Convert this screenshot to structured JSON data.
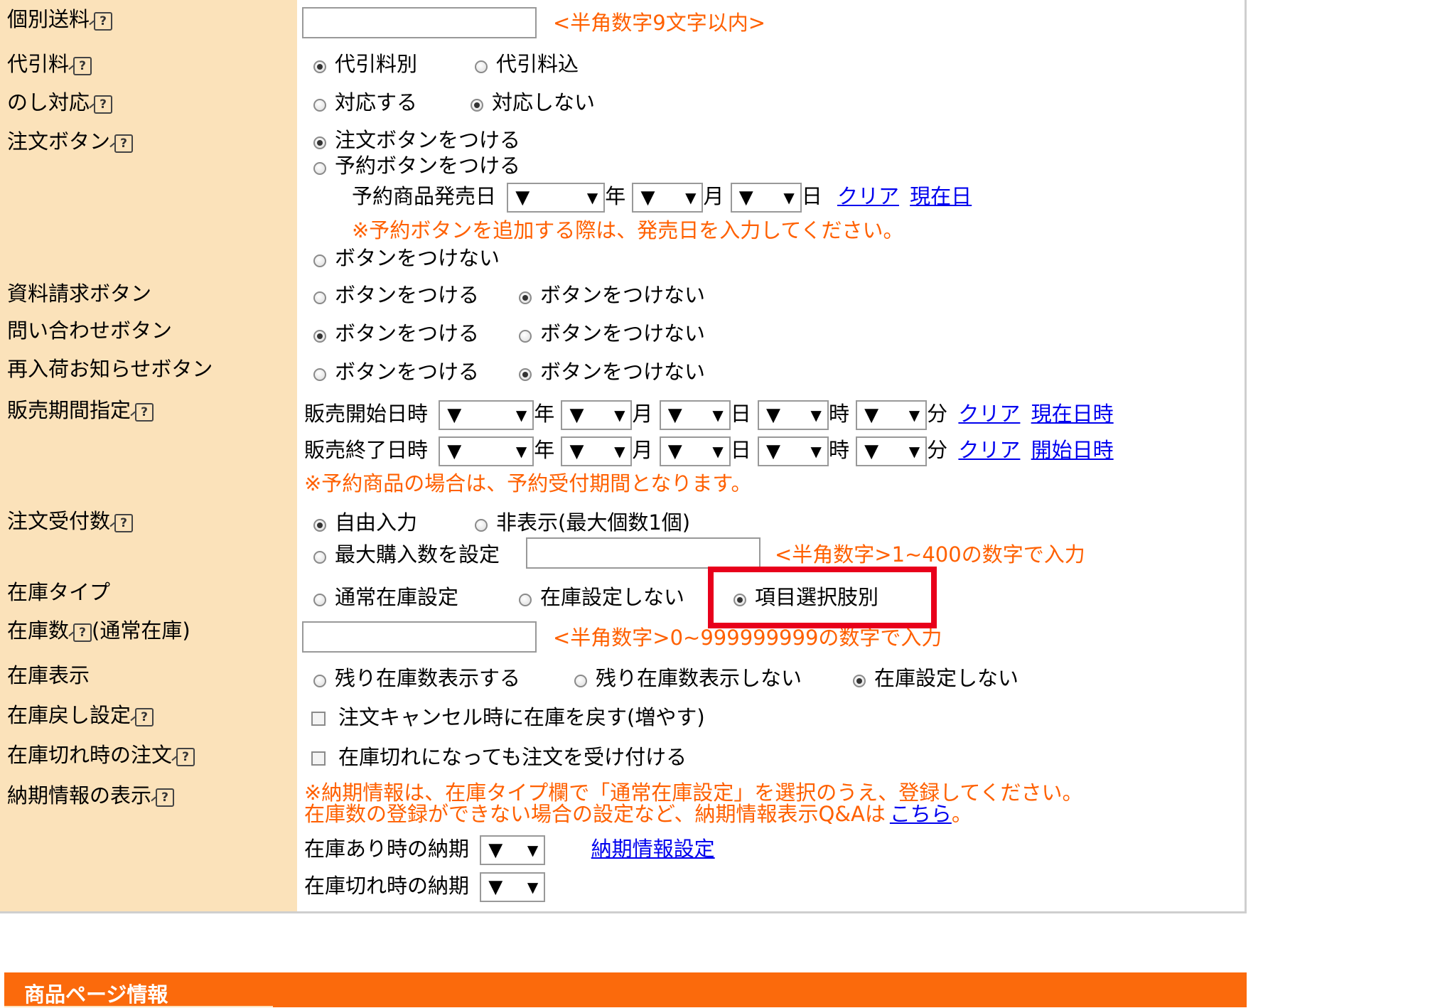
{
  "colors": {
    "label_bg": "#fbe2ba",
    "note": "#ff6000",
    "link": "#0000ee",
    "section_bar": "#fb6a0c",
    "highlight": "#e8001b"
  },
  "select_glyph": "▼",
  "rows": {
    "shipping": {
      "label": "個別送料",
      "note": "<半角数字9文字以内>"
    },
    "cod": {
      "label": "代引料",
      "opt1": "代引料別",
      "opt2": "代引料込"
    },
    "noshi": {
      "label": "のし対応",
      "opt1": "対応する",
      "opt2": "対応しない"
    },
    "order_button": {
      "label": "注文ボタン",
      "opt1": "注文ボタンをつける",
      "opt2": "予約ボタンをつける",
      "release_label": "予約商品発売日",
      "year": "年",
      "month": "月",
      "day": "日",
      "clear": "クリア",
      "today": "現在日",
      "note": "※予約ボタンを追加する際は、発売日を入力してください。",
      "opt3": "ボタンをつけない"
    },
    "request_button": {
      "label": "資料請求ボタン",
      "opt1": "ボタンをつける",
      "opt2": "ボタンをつけない"
    },
    "inquiry_button": {
      "label": "問い合わせボタン",
      "opt1": "ボタンをつける",
      "opt2": "ボタンをつけない"
    },
    "restock_button": {
      "label": "再入荷お知らせボタン",
      "opt1": "ボタンをつける",
      "opt2": "ボタンをつけない"
    },
    "sales_period": {
      "label": "販売期間指定",
      "start": "販売開始日時",
      "end": "販売終了日時",
      "year": "年",
      "month": "月",
      "day": "日",
      "hour": "時",
      "minute": "分",
      "clear": "クリア",
      "now": "現在日時",
      "start_link": "開始日時",
      "note": "※予約商品の場合は、予約受付期間となります。"
    },
    "order_qty": {
      "label": "注文受付数",
      "opt1": "自由入力",
      "opt2": "非表示(最大個数1個)",
      "opt3": "最大購入数を設定",
      "note": "<半角数字>1~400の数字で入力"
    },
    "stock_type": {
      "label": "在庫タイプ",
      "opt1": "通常在庫設定",
      "opt2": "在庫設定しない",
      "opt3": "項目選択肢別"
    },
    "stock_qty": {
      "label": "在庫数",
      "suffix": "(通常在庫)",
      "note": "<半角数字>0~999999999の数字で入力"
    },
    "stock_display": {
      "label": "在庫表示",
      "opt1": "残り在庫数表示する",
      "opt2": "残り在庫数表示しない",
      "opt3": "在庫設定しない"
    },
    "stock_return": {
      "label": "在庫戻し設定",
      "check": "注文キャンセル時に在庫を戻す(増やす)"
    },
    "out_of_stock": {
      "label": "在庫切れ時の注文",
      "check": "在庫切れになっても注文を受け付ける"
    },
    "delivery": {
      "label": "納期情報の表示",
      "note1": "※納期情報は、在庫タイプ欄で「通常在庫設定」を選択のうえ、登録してください。",
      "note2": "在庫数の登録ができない場合の設定など、納期情報表示Q&Aは",
      "here": "こちら",
      "period": "。",
      "in_stock": "在庫あり時の納期",
      "settings_link": "納期情報設定",
      "out_stock": "在庫切れ時の納期"
    }
  },
  "section": {
    "title": "商品ページ情報"
  }
}
